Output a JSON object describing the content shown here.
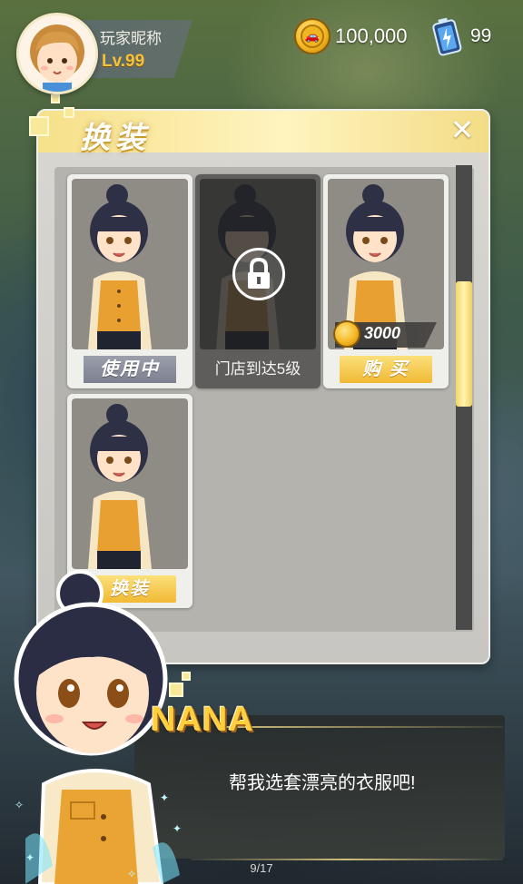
{
  "player": {
    "name": "玩家昵称",
    "level": "Lv.99"
  },
  "currency": {
    "coins": "100,000",
    "energy": "99"
  },
  "panel": {
    "title": "换装",
    "close": "✕"
  },
  "outfits": [
    {
      "button": "使用中",
      "state": "in-use"
    },
    {
      "lock_text": "门店到达5级",
      "state": "locked"
    },
    {
      "price": "3000",
      "button": "购 买",
      "state": "buy"
    },
    {
      "button": "换装",
      "state": "owned"
    }
  ],
  "dialog": {
    "speaker": "NANA",
    "text": "帮我选套漂亮的衣服吧!",
    "page": "9/17"
  },
  "colors": {
    "accent_gold": "#f6c13a",
    "header_yellow": "#f6e08a",
    "panel_gray": "#d9d7d2"
  }
}
